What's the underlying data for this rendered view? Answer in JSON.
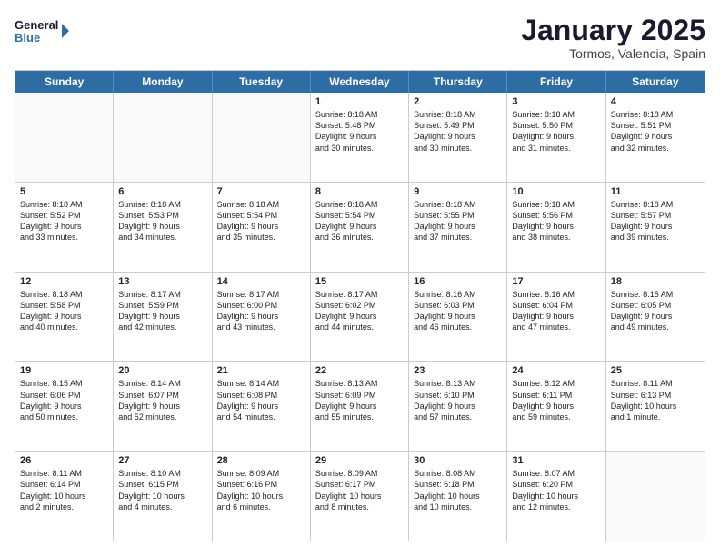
{
  "header": {
    "logo_line1": "General",
    "logo_line2": "Blue",
    "month_title": "January 2025",
    "location": "Tormos, Valencia, Spain"
  },
  "weekdays": [
    "Sunday",
    "Monday",
    "Tuesday",
    "Wednesday",
    "Thursday",
    "Friday",
    "Saturday"
  ],
  "rows": [
    [
      {
        "day": "",
        "text": ""
      },
      {
        "day": "",
        "text": ""
      },
      {
        "day": "",
        "text": ""
      },
      {
        "day": "1",
        "text": "Sunrise: 8:18 AM\nSunset: 5:48 PM\nDaylight: 9 hours\nand 30 minutes."
      },
      {
        "day": "2",
        "text": "Sunrise: 8:18 AM\nSunset: 5:49 PM\nDaylight: 9 hours\nand 30 minutes."
      },
      {
        "day": "3",
        "text": "Sunrise: 8:18 AM\nSunset: 5:50 PM\nDaylight: 9 hours\nand 31 minutes."
      },
      {
        "day": "4",
        "text": "Sunrise: 8:18 AM\nSunset: 5:51 PM\nDaylight: 9 hours\nand 32 minutes."
      }
    ],
    [
      {
        "day": "5",
        "text": "Sunrise: 8:18 AM\nSunset: 5:52 PM\nDaylight: 9 hours\nand 33 minutes."
      },
      {
        "day": "6",
        "text": "Sunrise: 8:18 AM\nSunset: 5:53 PM\nDaylight: 9 hours\nand 34 minutes."
      },
      {
        "day": "7",
        "text": "Sunrise: 8:18 AM\nSunset: 5:54 PM\nDaylight: 9 hours\nand 35 minutes."
      },
      {
        "day": "8",
        "text": "Sunrise: 8:18 AM\nSunset: 5:54 PM\nDaylight: 9 hours\nand 36 minutes."
      },
      {
        "day": "9",
        "text": "Sunrise: 8:18 AM\nSunset: 5:55 PM\nDaylight: 9 hours\nand 37 minutes."
      },
      {
        "day": "10",
        "text": "Sunrise: 8:18 AM\nSunset: 5:56 PM\nDaylight: 9 hours\nand 38 minutes."
      },
      {
        "day": "11",
        "text": "Sunrise: 8:18 AM\nSunset: 5:57 PM\nDaylight: 9 hours\nand 39 minutes."
      }
    ],
    [
      {
        "day": "12",
        "text": "Sunrise: 8:18 AM\nSunset: 5:58 PM\nDaylight: 9 hours\nand 40 minutes."
      },
      {
        "day": "13",
        "text": "Sunrise: 8:17 AM\nSunset: 5:59 PM\nDaylight: 9 hours\nand 42 minutes."
      },
      {
        "day": "14",
        "text": "Sunrise: 8:17 AM\nSunset: 6:00 PM\nDaylight: 9 hours\nand 43 minutes."
      },
      {
        "day": "15",
        "text": "Sunrise: 8:17 AM\nSunset: 6:02 PM\nDaylight: 9 hours\nand 44 minutes."
      },
      {
        "day": "16",
        "text": "Sunrise: 8:16 AM\nSunset: 6:03 PM\nDaylight: 9 hours\nand 46 minutes."
      },
      {
        "day": "17",
        "text": "Sunrise: 8:16 AM\nSunset: 6:04 PM\nDaylight: 9 hours\nand 47 minutes."
      },
      {
        "day": "18",
        "text": "Sunrise: 8:15 AM\nSunset: 6:05 PM\nDaylight: 9 hours\nand 49 minutes."
      }
    ],
    [
      {
        "day": "19",
        "text": "Sunrise: 8:15 AM\nSunset: 6:06 PM\nDaylight: 9 hours\nand 50 minutes."
      },
      {
        "day": "20",
        "text": "Sunrise: 8:14 AM\nSunset: 6:07 PM\nDaylight: 9 hours\nand 52 minutes."
      },
      {
        "day": "21",
        "text": "Sunrise: 8:14 AM\nSunset: 6:08 PM\nDaylight: 9 hours\nand 54 minutes."
      },
      {
        "day": "22",
        "text": "Sunrise: 8:13 AM\nSunset: 6:09 PM\nDaylight: 9 hours\nand 55 minutes."
      },
      {
        "day": "23",
        "text": "Sunrise: 8:13 AM\nSunset: 6:10 PM\nDaylight: 9 hours\nand 57 minutes."
      },
      {
        "day": "24",
        "text": "Sunrise: 8:12 AM\nSunset: 6:11 PM\nDaylight: 9 hours\nand 59 minutes."
      },
      {
        "day": "25",
        "text": "Sunrise: 8:11 AM\nSunset: 6:13 PM\nDaylight: 10 hours\nand 1 minute."
      }
    ],
    [
      {
        "day": "26",
        "text": "Sunrise: 8:11 AM\nSunset: 6:14 PM\nDaylight: 10 hours\nand 2 minutes."
      },
      {
        "day": "27",
        "text": "Sunrise: 8:10 AM\nSunset: 6:15 PM\nDaylight: 10 hours\nand 4 minutes."
      },
      {
        "day": "28",
        "text": "Sunrise: 8:09 AM\nSunset: 6:16 PM\nDaylight: 10 hours\nand 6 minutes."
      },
      {
        "day": "29",
        "text": "Sunrise: 8:09 AM\nSunset: 6:17 PM\nDaylight: 10 hours\nand 8 minutes."
      },
      {
        "day": "30",
        "text": "Sunrise: 8:08 AM\nSunset: 6:18 PM\nDaylight: 10 hours\nand 10 minutes."
      },
      {
        "day": "31",
        "text": "Sunrise: 8:07 AM\nSunset: 6:20 PM\nDaylight: 10 hours\nand 12 minutes."
      },
      {
        "day": "",
        "text": ""
      }
    ]
  ]
}
